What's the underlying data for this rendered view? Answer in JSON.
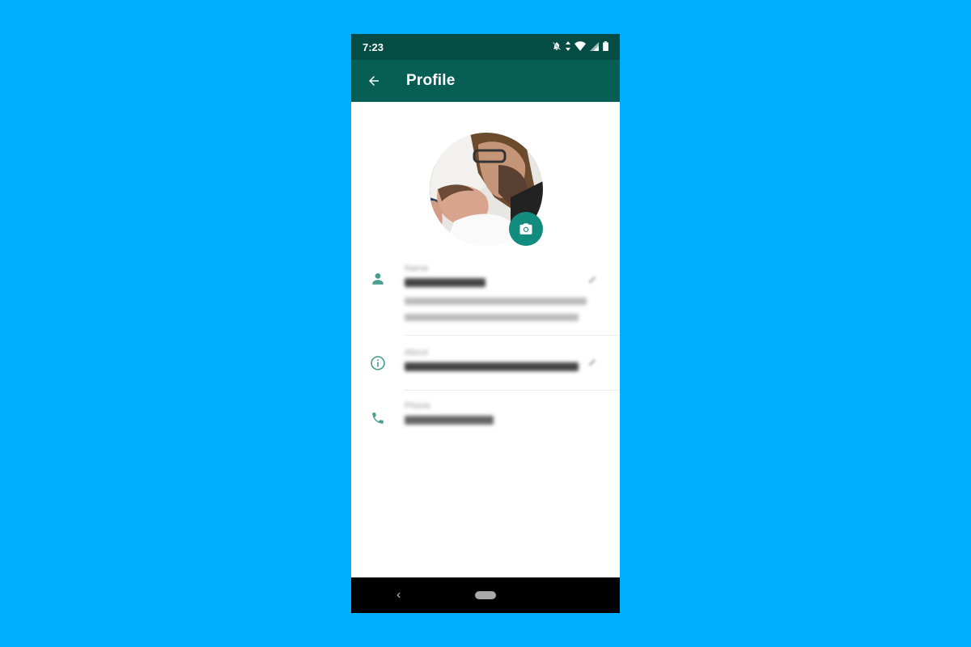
{
  "statusbar": {
    "time": "7:23",
    "icons": [
      "notifications-off-icon",
      "data-arrows-icon",
      "wifi-icon",
      "cellular-signal-icon",
      "battery-icon"
    ]
  },
  "appbar": {
    "back_icon": "arrow-back-icon",
    "title": "Profile"
  },
  "profile": {
    "avatar_description": "Profile photo: man with glasses and beard holding a newborn baby",
    "camera_icon": "camera-icon",
    "fields": [
      {
        "icon": "person-icon",
        "label": "Name",
        "value": "[blurred]",
        "hint": "[blurred helper text]",
        "editable": true
      },
      {
        "icon": "info-icon",
        "label": "About",
        "value": "[blurred]",
        "editable": true
      },
      {
        "icon": "phone-icon",
        "label": "Phone",
        "value": "[blurred]",
        "editable": false
      }
    ]
  },
  "navbar": {
    "back_label": "‹"
  },
  "colors": {
    "background": "#00aeff",
    "statusbar": "#054d44",
    "appbar": "#075e54",
    "accent": "#128c7e",
    "icon_teal": "#4a9e8e"
  }
}
